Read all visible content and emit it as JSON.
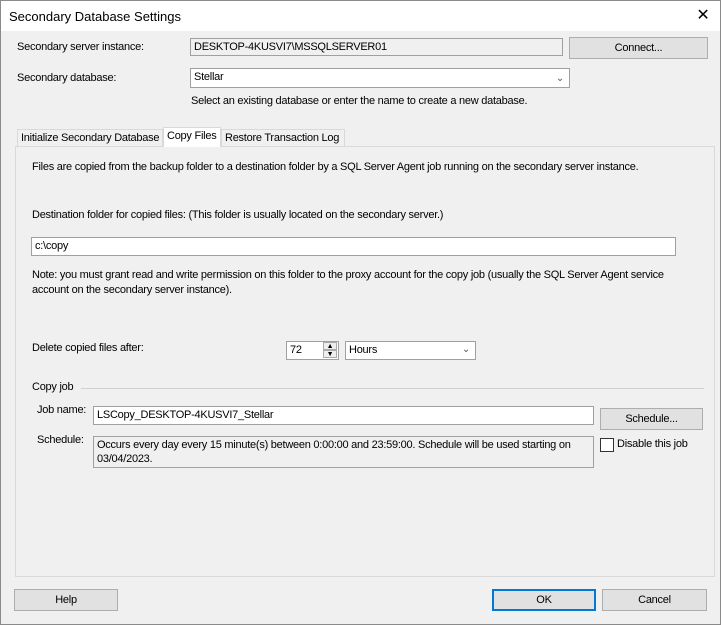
{
  "window": {
    "title": "Secondary Database Settings",
    "close_icon": "close-icon"
  },
  "server": {
    "label": "Secondary server instance:",
    "value": "DESKTOP-4KUSVI7\\MSSQLSERVER01",
    "connect": "Connect..."
  },
  "database": {
    "label": "Secondary database:",
    "value": "Stellar",
    "hint": "Select an existing database or enter the name to create a new database."
  },
  "tabs": [
    {
      "label": "Initialize Secondary Database"
    },
    {
      "label": "Copy Files",
      "selected": true
    },
    {
      "label": "Restore Transaction Log"
    }
  ],
  "copy": {
    "intro": "Files are copied from the backup folder to a destination folder by a SQL Server Agent job running on the secondary server instance.",
    "dest_label": "Destination folder for copied files: (This folder is usually located on the secondary server.)",
    "dest_value": "c:\\copy",
    "note1": "Note: you must grant read and write permission on this folder to the proxy account for the copy job (usually the SQL Server Agent service",
    "note2": "account on the secondary server instance).",
    "delete_label": "Delete copied files after:",
    "delete_value": "72",
    "delete_unit": "Hours",
    "group_label": "Copy job",
    "job_label": "Job name:",
    "job_value": "LSCopy_DESKTOP-4KUSVI7_Stellar",
    "schedule_button": "Schedule...",
    "schedule_label": "Schedule:",
    "schedule_line1": "Occurs every day every 15 minute(s) between 0:00:00 and 23:59:00. Schedule will be used starting on",
    "schedule_line2": "03/04/2023.",
    "disable_label": "Disable this job",
    "disable_checked": false
  },
  "footer": {
    "help": "Help",
    "ok": "OK",
    "cancel": "Cancel"
  }
}
